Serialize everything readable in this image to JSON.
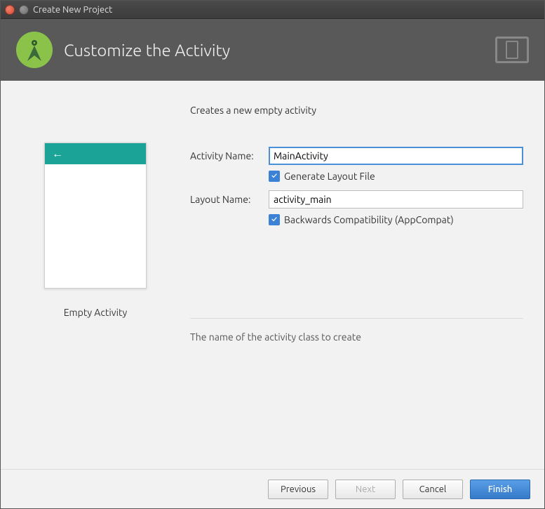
{
  "window": {
    "title": "Create New Project"
  },
  "header": {
    "title": "Customize the Activity"
  },
  "form": {
    "description": "Creates a new empty activity",
    "activity_name_label": "Activity Name:",
    "activity_name_value": "MainActivity",
    "generate_layout_label": "Generate Layout File",
    "generate_layout_checked": true,
    "layout_name_label": "Layout Name:",
    "layout_name_value": "activity_main",
    "backwards_compat_label": "Backwards Compatibility (AppCompat)",
    "backwards_compat_checked": true,
    "hint": "The name of the activity class to create"
  },
  "preview": {
    "label": "Empty Activity"
  },
  "footer": {
    "previous": "Previous",
    "next": "Next",
    "cancel": "Cancel",
    "finish": "Finish"
  }
}
